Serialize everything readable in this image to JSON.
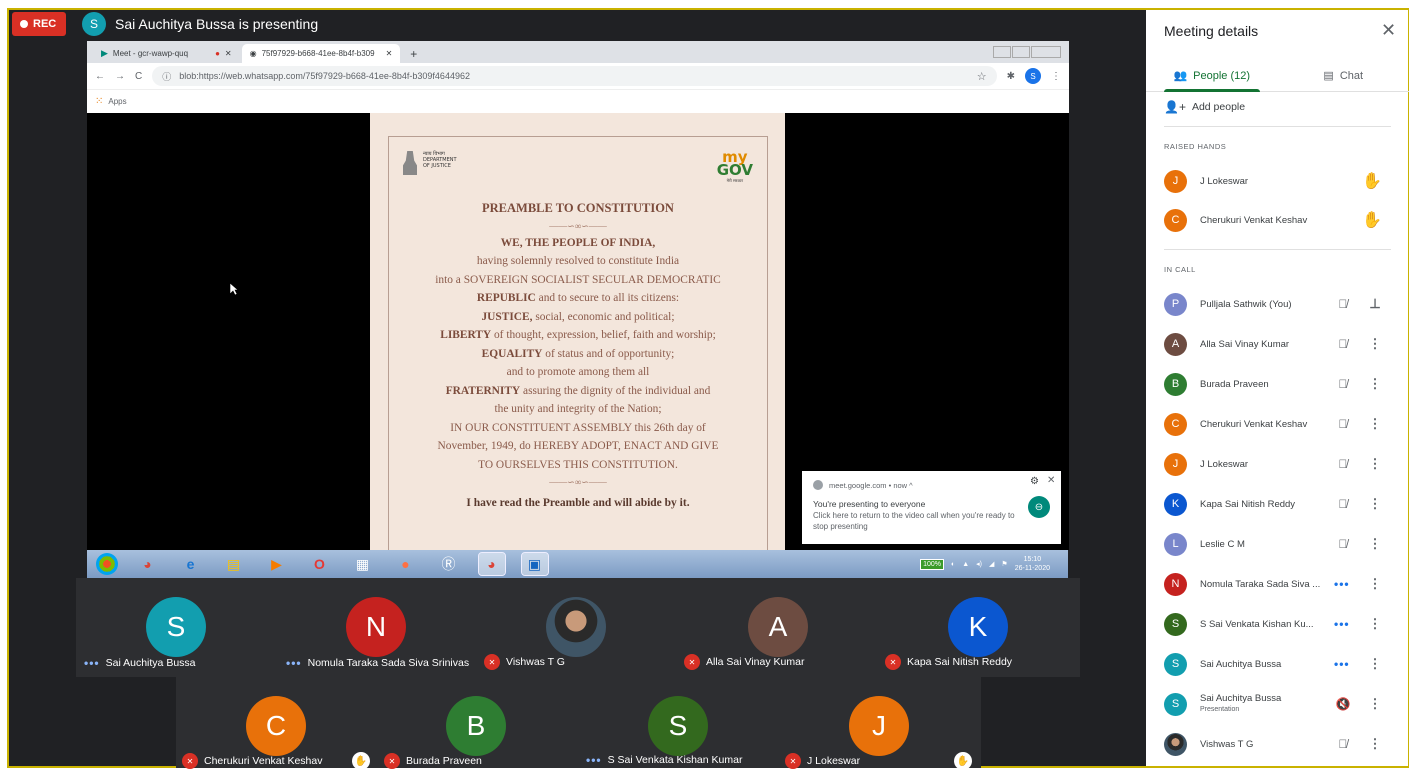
{
  "recording": {
    "label": "REC"
  },
  "presenter": {
    "initial": "S",
    "text": "Sai Auchitya Bussa is presenting"
  },
  "browser": {
    "tabs": [
      {
        "label": "Meet - gcr-wawp-quq",
        "active": false
      },
      {
        "label": "75f97929-b668-41ee-8b4f-b309",
        "active": true
      }
    ],
    "new_tab": "+",
    "url": "blob:https://web.whatsapp.com/75f97929-b668-41ee-8b4f-b309f4644962",
    "profile_initial": "S",
    "bookmarks_label": "Apps"
  },
  "document": {
    "dept_line1": "न्याय विभाग",
    "dept_line2": "DEPARTMENT",
    "dept_line3": "OF JUSTICE",
    "mygov_my": "my",
    "mygov_gov": "GOV",
    "mygov_hindi": "मेरी सरकार",
    "title": "PREAMBLE TO CONSTITUTION",
    "flourish": "——∽∞∽——",
    "line1": "WE, THE PEOPLE OF INDIA,",
    "line2": "having solemnly resolved to constitute India",
    "line3": "into a SOVEREIGN SOCIALIST SECULAR DEMOCRATIC",
    "line4_b": "REPUBLIC",
    "line4": "and to secure to all its citizens:",
    "line5_b": "JUSTICE,",
    "line5": "social, economic and political;",
    "line6_b": "LIBERTY",
    "line6": "of thought, expression, belief, faith and worship;",
    "line7_b": "EQUALITY",
    "line7": "of status and of opportunity;",
    "line8": "and to promote among them all",
    "line9_b": "FRATERNITY",
    "line9": "assuring the dignity of the individual and",
    "line10": "the unity and integrity of the Nation;",
    "line11": "IN OUR CONSTITUENT ASSEMBLY this 26th day of",
    "line12": "November, 1949, do HEREBY ADOPT, ENACT AND GIVE",
    "line13": "TO OURSELVES THIS CONSTITUTION.",
    "pledge": "I have read the Preamble and will abide by it."
  },
  "taskbar": {
    "battery": "100%",
    "time": "15:10",
    "date": "26-11-2020"
  },
  "toast": {
    "source": "meet.google.com • now ^",
    "message": "You're presenting to everyone",
    "sub": "Click here to return to the video call when you're ready to stop presenting"
  },
  "tiles": [
    {
      "initial": "S",
      "name": "Sai Auchitya Bussa",
      "color": "#129eaf",
      "status": "speaking"
    },
    {
      "initial": "N",
      "name": "Nomula Taraka Sada Siva Srinivas",
      "color": "#c5221f",
      "status": "speaking"
    },
    {
      "initial": "",
      "name": "Vishwas T G",
      "color": "#2a3b47",
      "status": "muted"
    },
    {
      "initial": "A",
      "name": "Alla Sai Vinay Kumar",
      "color": "#6d4c41",
      "status": "muted"
    },
    {
      "initial": "K",
      "name": "Kapa Sai Nitish Reddy",
      "color": "#0b57d0",
      "status": "muted"
    },
    {
      "initial": "C",
      "name": "Cherukuri Venkat Keshav",
      "color": "#e8710a",
      "status": "muted"
    },
    {
      "initial": "B",
      "name": "Burada Praveen",
      "color": "#2e7d32",
      "status": "muted"
    },
    {
      "initial": "S",
      "name": "S Sai Venkata Kishan Kumar",
      "color": "#33691e",
      "status": "speaking"
    },
    {
      "initial": "J",
      "name": "J Lokeswar",
      "color": "#e8710a",
      "status": "muted"
    }
  ],
  "panel": {
    "title": "Meeting details",
    "tab_people": "People (12)",
    "tab_chat": "Chat",
    "add_people": "Add people",
    "raised_hands_label": "RAISED HANDS",
    "raised_hands": [
      {
        "initial": "J",
        "name": "J Lokeswar",
        "color": "#e8710a"
      },
      {
        "initial": "C",
        "name": "Cherukuri Venkat Keshav",
        "color": "#e8710a"
      }
    ],
    "in_call_label": "IN CALL",
    "in_call": [
      {
        "initial": "P",
        "name": "Pulljala Sathwik (You)",
        "color": "#7986cb",
        "sub": "",
        "state": "muted",
        "action": "pin"
      },
      {
        "initial": "A",
        "name": "Alla Sai Vinay Kumar",
        "color": "#6d4c41",
        "sub": "",
        "state": "muted",
        "action": "more"
      },
      {
        "initial": "B",
        "name": "Burada Praveen",
        "color": "#2e7d32",
        "sub": "",
        "state": "muted",
        "action": "more"
      },
      {
        "initial": "C",
        "name": "Cherukuri Venkat Keshav",
        "color": "#e8710a",
        "sub": "",
        "state": "muted",
        "action": "more"
      },
      {
        "initial": "J",
        "name": "J Lokeswar",
        "color": "#e8710a",
        "sub": "",
        "state": "muted",
        "action": "more"
      },
      {
        "initial": "K",
        "name": "Kapa Sai Nitish Reddy",
        "color": "#0b57d0",
        "sub": "",
        "state": "muted",
        "action": "more"
      },
      {
        "initial": "L",
        "name": "Leslie C M",
        "color": "#7986cb",
        "sub": "",
        "state": "muted",
        "action": "more"
      },
      {
        "initial": "N",
        "name": "Nomula Taraka Sada Siva ...",
        "color": "#c5221f",
        "sub": "",
        "state": "speaking",
        "action": "more"
      },
      {
        "initial": "S",
        "name": "S Sai Venkata Kishan Ku...",
        "color": "#33691e",
        "sub": "",
        "state": "speaking",
        "action": "more"
      },
      {
        "initial": "S",
        "name": "Sai Auchitya Bussa",
        "color": "#129eaf",
        "sub": "",
        "state": "speaking",
        "action": "more"
      },
      {
        "initial": "S",
        "name": "Sai Auchitya Bussa",
        "color": "#129eaf",
        "sub": "Presentation",
        "state": "audio-off",
        "action": "more"
      },
      {
        "initial": "",
        "name": "Vishwas T G",
        "color": "#2a3b47",
        "sub": "",
        "state": "muted",
        "action": "more"
      }
    ]
  }
}
